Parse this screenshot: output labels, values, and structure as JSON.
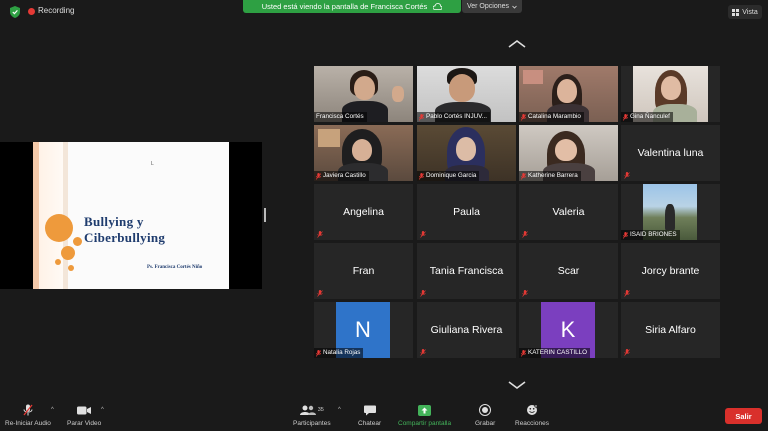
{
  "topbar": {
    "recording_label": "Recording",
    "share_banner": "Usted está viendo la pantalla de Francisca Cortés",
    "view_options": "Ver Opciones",
    "view_label": "Vista"
  },
  "slide": {
    "title_line1": "Bullying y",
    "title_line2": "Ciberbullying",
    "author": "Ps. Francisca Cortés Niño",
    "cursor_mark": "L"
  },
  "participants": [
    {
      "name": "Francisca Cortés",
      "video": true,
      "active": true
    },
    {
      "name": "Pablo Cortés INJUV...",
      "video": true
    },
    {
      "name": "Catalina Marambio",
      "video": true
    },
    {
      "name": "Gina Ñanculef",
      "video": true
    },
    {
      "name": "Javiera Castillo",
      "video": true
    },
    {
      "name": "Dominique Garcia",
      "video": true
    },
    {
      "name": "Katherine Barrera",
      "video": true
    },
    {
      "name": "Valentina luna",
      "video": false
    },
    {
      "name": "Angelina",
      "video": false
    },
    {
      "name": "Paula",
      "video": false
    },
    {
      "name": "Valeria",
      "video": false
    },
    {
      "name": "ISAID BRIONES",
      "video": true
    },
    {
      "name": "Fran",
      "video": false
    },
    {
      "name": "Tania Francisca",
      "video": false
    },
    {
      "name": "Scar",
      "video": false
    },
    {
      "name": "Jorcy brante",
      "video": false
    },
    {
      "name": "Natalia Rojas",
      "avatar_letter": "N",
      "avatar_color": "#2f74c9"
    },
    {
      "name": "Giuliana Rivera",
      "video": false
    },
    {
      "name": "KATERIN CASTILLO",
      "avatar_letter": "K",
      "avatar_color": "#7b3fbf"
    },
    {
      "name": "Siria Alfaro",
      "video": false
    }
  ],
  "toolbar": {
    "audio_label": "Re-Iniciar Audio",
    "video_label": "Parar Video",
    "participants_label": "Participantes",
    "participants_count": "35",
    "chat_label": "Chatear",
    "share_label": "Compartir pantalla",
    "record_label": "Grabar",
    "reactions_label": "Reacciones",
    "leave_label": "Salir"
  },
  "colors": {
    "share_banner": "#2ea043",
    "active_speaker": "#9bd54d",
    "leave_button": "#d9302b",
    "slide_title": "#1f3c6e",
    "slide_accent": "#ee9a3c"
  },
  "icons": [
    "shield-icon",
    "record-dot-icon",
    "cloud-icon",
    "chevron-down-icon",
    "grid-icon",
    "chevron-up-icon",
    "mic-muted-icon",
    "video-camera-icon",
    "participants-icon",
    "chat-icon",
    "share-screen-icon",
    "record-icon",
    "reactions-icon"
  ]
}
